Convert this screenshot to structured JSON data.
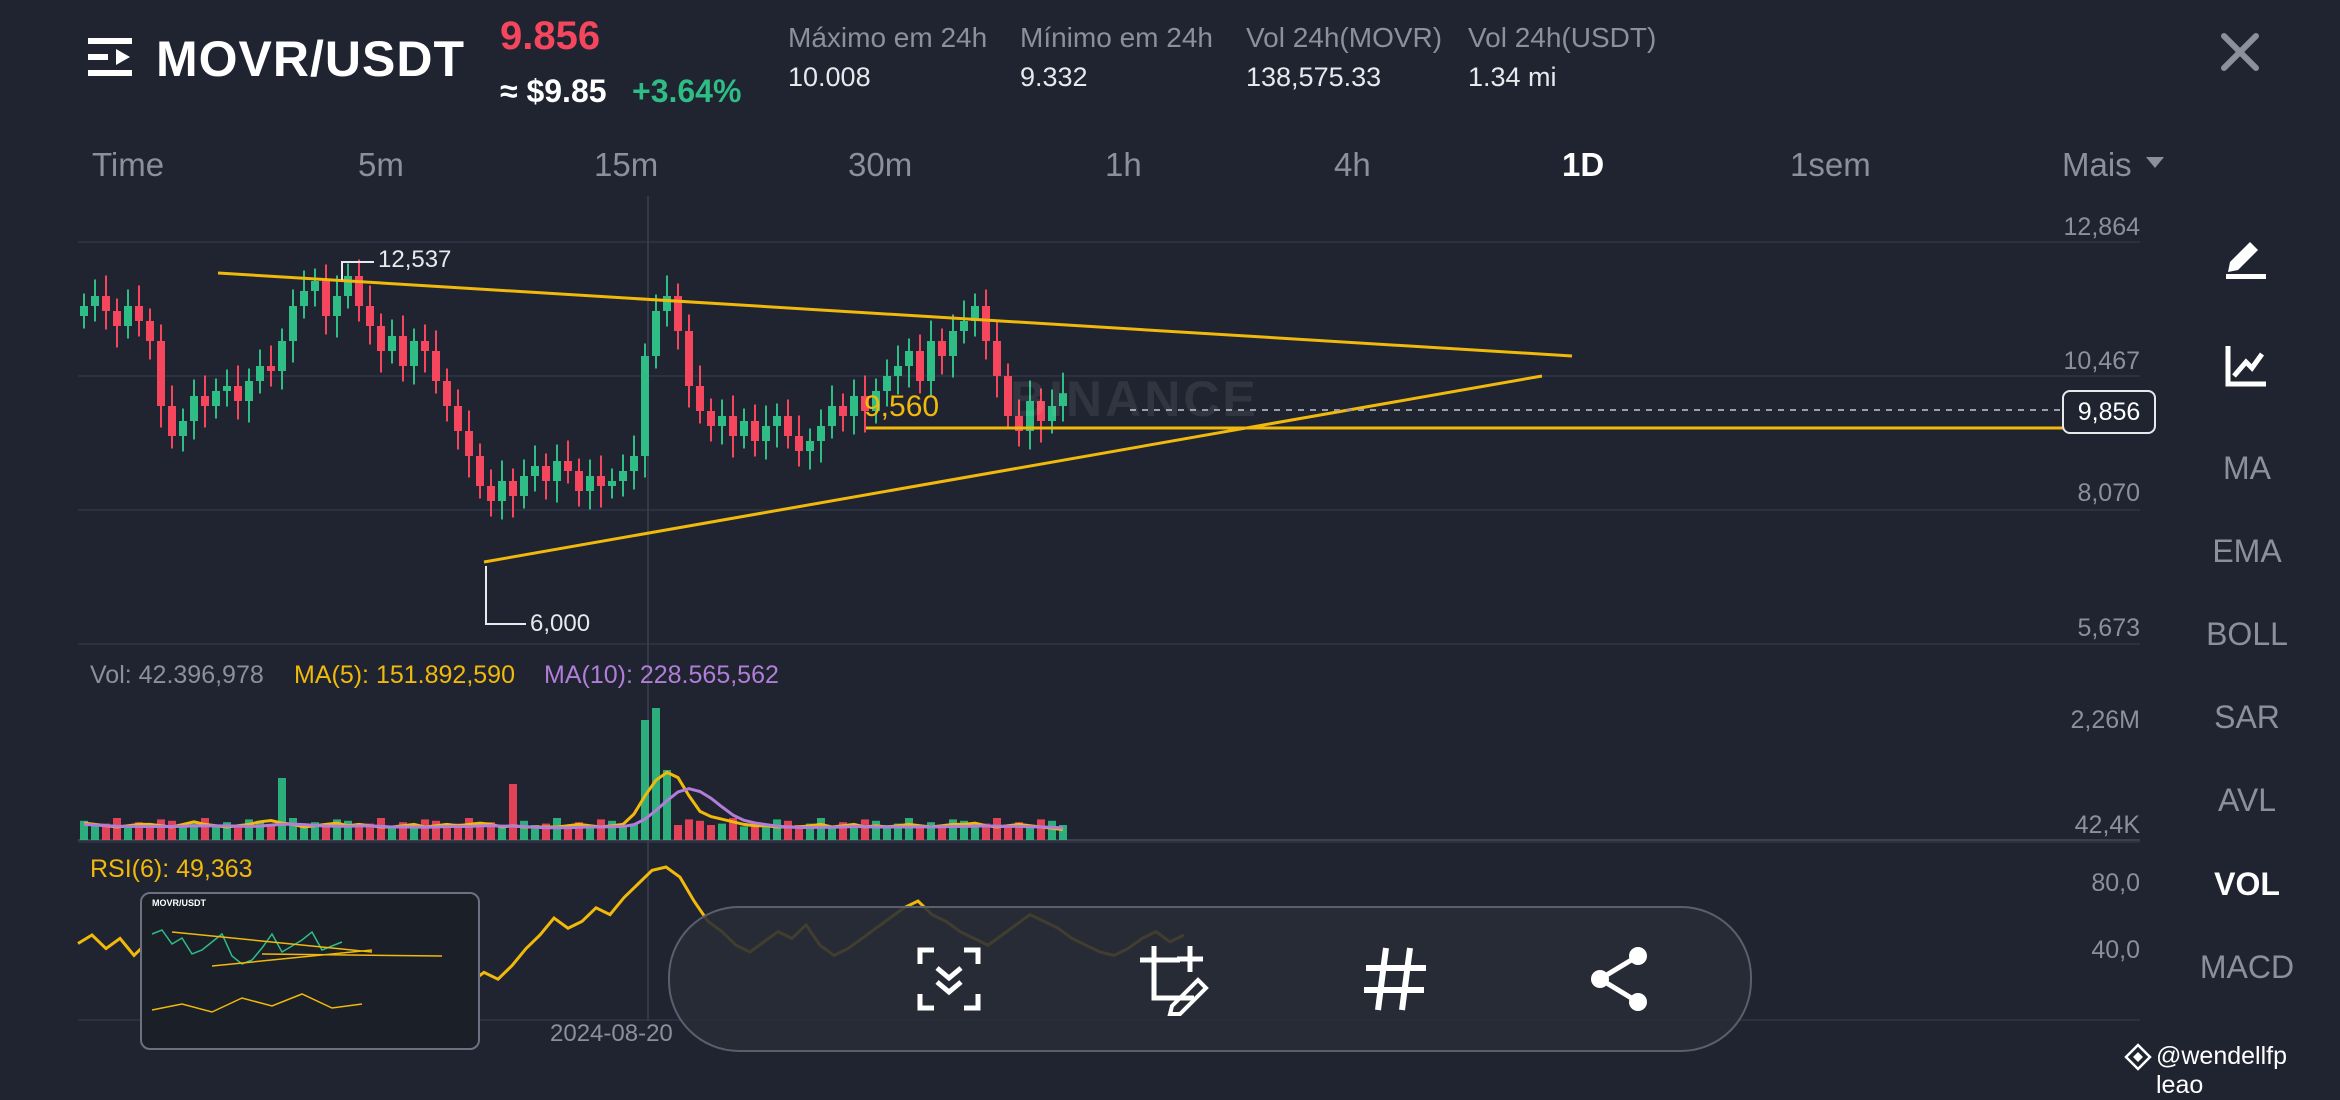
{
  "header": {
    "pair": "MOVR/USDT",
    "price": "9.856",
    "usd_price": "≈ $9.85",
    "change": "+3.64%",
    "stats": [
      {
        "label": "Máximo em 24h",
        "value": "10.008"
      },
      {
        "label": "Mínimo em 24h",
        "value": "9.332"
      },
      {
        "label": "Vol 24h(MOVR)",
        "value": "138,575.33"
      },
      {
        "label": "Vol 24h(USDT)",
        "value": "1.34 mi"
      }
    ]
  },
  "timeframes": [
    "Time",
    "5m",
    "15m",
    "30m",
    "1h",
    "4h",
    "1D",
    "1sem",
    "Mais"
  ],
  "active_timeframe": "1D",
  "right_toolbar": [
    "MA",
    "EMA",
    "BOLL",
    "SAR",
    "AVL",
    "VOL",
    "MACD"
  ],
  "active_indicator": "VOL",
  "price_axis": [
    "12,864",
    "10,467",
    "8,070",
    "5,673"
  ],
  "price_tag": "9,856",
  "annotations": {
    "high": "12,537",
    "low": "6,000",
    "level": "9,560"
  },
  "volume": {
    "vol_label": "Vol: 42.396,978",
    "ma5_label": "MA(5): 151.892,590",
    "ma10_label": "MA(10): 228.565,562",
    "axis": [
      "2,26M",
      "42,4K"
    ]
  },
  "rsi": {
    "label": "RSI(6): 49,363",
    "axis": [
      "80,0",
      "40,0"
    ]
  },
  "date_label": "2024-08-20 ",
  "watermark_brand": "BINANCE",
  "watermark_user": "@wendellfp leao",
  "thumb_title": "MOVR/USDT",
  "colors": {
    "up": "#2ebd85",
    "down": "#f6465d",
    "trend": "#f0b90b",
    "ma10": "#b07ed8",
    "bg": "#1f2430"
  },
  "chart_data": {
    "type": "candlestick",
    "ylim": [
      5.2,
      13.2
    ],
    "closes": [
      11.6,
      11.8,
      11.5,
      11.2,
      11.6,
      11.3,
      10.9,
      9.6,
      9.0,
      9.3,
      9.8,
      9.6,
      9.9,
      10.0,
      9.7,
      10.1,
      10.4,
      10.3,
      10.9,
      11.6,
      11.9,
      12.1,
      11.4,
      11.8,
      12.2,
      11.6,
      11.2,
      10.7,
      11.0,
      10.4,
      10.9,
      10.7,
      10.1,
      9.6,
      9.1,
      8.6,
      8.0,
      7.7,
      8.1,
      7.8,
      8.2,
      8.4,
      8.1,
      8.5,
      8.3,
      7.9,
      8.2,
      8.0,
      8.1,
      8.3,
      8.6,
      10.6,
      11.5,
      11.8,
      11.1,
      10.0,
      9.5,
      9.2,
      9.4,
      9.0,
      9.3,
      8.9,
      9.2,
      9.4,
      9.0,
      8.7,
      8.9,
      9.2,
      9.6,
      9.4,
      9.8,
      9.5,
      9.9,
      10.2,
      10.4,
      10.7,
      10.1,
      10.9,
      10.6,
      11.1,
      11.3,
      11.6,
      10.9,
      10.2,
      9.4,
      9.1,
      9.7,
      9.3,
      9.6,
      9.856
    ],
    "volume_ma5": [
      0.13,
      0.12,
      0.11,
      0.1,
      0.11,
      0.12,
      0.12,
      0.11,
      0.1,
      0.12,
      0.14,
      0.12,
      0.11,
      0.1,
      0.11,
      0.12,
      0.14,
      0.15,
      0.13,
      0.12,
      0.1,
      0.11,
      0.12,
      0.13,
      0.11,
      0.12,
      0.11,
      0.1,
      0.1,
      0.11,
      0.12,
      0.1,
      0.11,
      0.12,
      0.11,
      0.12,
      0.13,
      0.12,
      0.1,
      0.11,
      0.1,
      0.1,
      0.1,
      0.1,
      0.11,
      0.12,
      0.11,
      0.1,
      0.11,
      0.12,
      0.2,
      0.34,
      0.46,
      0.52,
      0.48,
      0.34,
      0.22,
      0.18,
      0.16,
      0.14,
      0.12,
      0.11,
      0.11,
      0.1,
      0.1,
      0.1,
      0.11,
      0.12,
      0.1,
      0.11,
      0.12,
      0.1,
      0.11,
      0.1,
      0.11,
      0.12,
      0.11,
      0.1,
      0.11,
      0.12,
      0.12,
      0.13,
      0.11,
      0.1,
      0.11,
      0.12,
      0.11,
      0.1,
      0.09,
      0.08
    ],
    "rsi": [
      45,
      50,
      42,
      48,
      38,
      46,
      55,
      58,
      52,
      47,
      40,
      55,
      60,
      52,
      46,
      38,
      42,
      50,
      48,
      40,
      45,
      52,
      44,
      38,
      42,
      36,
      30,
      26,
      22,
      28,
      24,
      32,
      42,
      50,
      60,
      54,
      58,
      66,
      62,
      72,
      80,
      88,
      90,
      84,
      70,
      58,
      52,
      44,
      40,
      46,
      52,
      48,
      56,
      44,
      38,
      42,
      48,
      54,
      60,
      66,
      70,
      62,
      58,
      52,
      48,
      44,
      50,
      56,
      62,
      58,
      54,
      48,
      44,
      40,
      38,
      42,
      48,
      52,
      46,
      50
    ]
  }
}
